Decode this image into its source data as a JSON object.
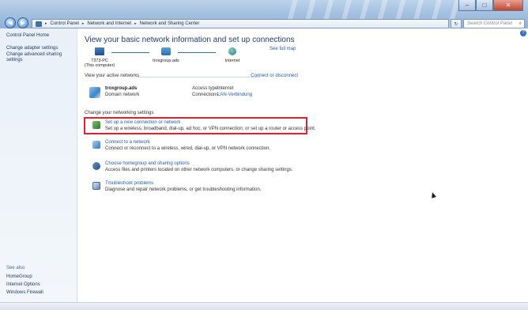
{
  "window": {
    "controls": {
      "minimize": "–",
      "maximize": "□",
      "close": "✕"
    }
  },
  "nav": {
    "back": "◀",
    "forward": "▶"
  },
  "address_bar": {
    "crumbs": [
      "Control Panel",
      "Network and Internet",
      "Network and Sharing Center"
    ],
    "separator": "▸",
    "refresh": "↻"
  },
  "search": {
    "placeholder": "Search Control Panel",
    "icon": "⌕"
  },
  "left_pane": {
    "home": "Control Panel Home",
    "links": [
      "Change adapter settings",
      "Change advanced sharing",
      "settings"
    ],
    "see_also_header": "See also",
    "see_also": [
      "HomeGroup",
      "Internet Options",
      "Windows Firewall"
    ]
  },
  "main": {
    "help": "?",
    "title": "View your basic network information and set up connections",
    "see_full_map": "See full map",
    "map_nodes": [
      {
        "name": "7373-PC",
        "sub": "(This computer)",
        "icon": "pc-icon"
      },
      {
        "name": "troxgroup.ads",
        "sub": "",
        "icon": "network-icon"
      },
      {
        "name": "Internet",
        "sub": "",
        "icon": "globe-icon"
      }
    ],
    "active_header": "View your active networks",
    "connect_disconnect": "Connect or disconnect",
    "active_network": {
      "name": "troxgroup.ads",
      "type": "Domain network",
      "access_type_label": "Access type:",
      "access_type": "Internet",
      "connections_label": "Connections:",
      "connections": "LAN-Verbindung"
    },
    "change_header": "Change your networking settings",
    "tasks": [
      {
        "title": "Set up a new connection or network",
        "desc": "Set up a wireless, broadband, dial-up, ad hoc, or VPN connection; or set up a router or access point.",
        "icon": "new-connection-icon"
      },
      {
        "title": "Connect to a network",
        "desc": "Connect or reconnect to a wireless, wired, dial-up, or VPN network connection.",
        "icon": "connect-network-icon"
      },
      {
        "title": "Choose homegroup and sharing options",
        "desc": "Access files and printers located on other network computers, or change sharing settings.",
        "icon": "homegroup-icon"
      },
      {
        "title": "Troubleshoot problems",
        "desc": "Diagnose and repair network problems, or get troubleshooting information.",
        "icon": "troubleshoot-icon"
      }
    ]
  },
  "colors": {
    "accent": "#1f5bb3",
    "highlight": "#e0202a",
    "title": "#1e3c6e"
  }
}
